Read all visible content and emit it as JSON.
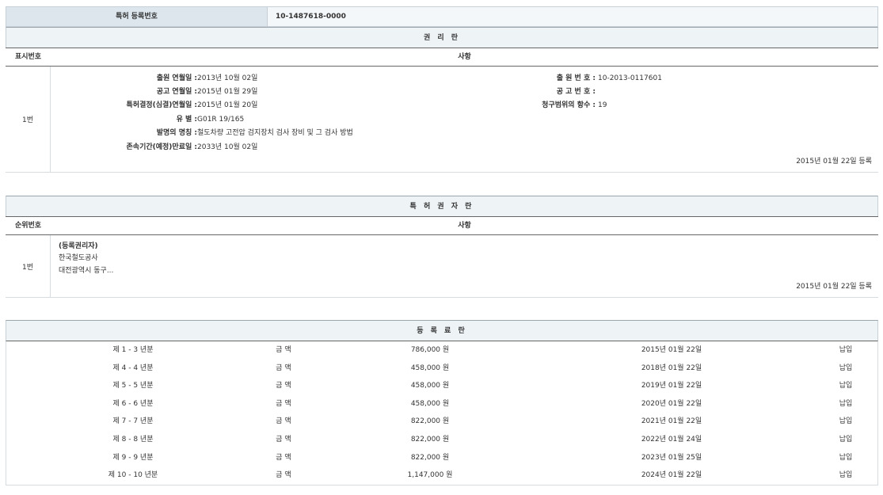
{
  "registration": {
    "label": "특허 등록번호",
    "number": "10-1487618-0000"
  },
  "rights_section": {
    "title": "권 리 란",
    "col_index": "표시번호",
    "col_details": "사항",
    "entry_index": "1번",
    "fields_left": [
      {
        "key": "출원 연월일 : ",
        "value": "2013년 10월 02일"
      },
      {
        "key": "공고 연월일 : ",
        "value": "2015년 01월 29일"
      },
      {
        "key": "특허결정(심결)연월일 : ",
        "value": "2015년 01월 20일"
      },
      {
        "key": "유 별 : ",
        "value": "G01R 19/165"
      },
      {
        "key": "발명의 명칭 : ",
        "value": "철도차량 고전압 검지장치 검사 장비 및 그 검사 방법"
      },
      {
        "key": "존속기간(예정)만료일 : ",
        "value": "2033년 10월 02일"
      }
    ],
    "fields_right": [
      {
        "key": "출 원 번 호 : ",
        "value": "10-2013-0117601"
      },
      {
        "key": "공 고 번 호 : ",
        "value": ""
      },
      {
        "key": "청구범위의 항수 : ",
        "value": "19"
      }
    ],
    "registered_date": "2015년 01월 22일 등록"
  },
  "holder_section": {
    "title": "특 허 권 자 란",
    "col_index": "순위번호",
    "col_details": "사항",
    "entry_index": "1번",
    "lines": [
      "(등록권리자)",
      "한국철도공사",
      "대전광역시 동구..."
    ],
    "registered_date": "2015년 01월 22일 등록"
  },
  "fee_section": {
    "title": "등 록 료 란",
    "rows": [
      {
        "year": "제 1 - 3 년분",
        "label": "금 액",
        "amount": "786,000 원",
        "date": "2015년 01월 22일",
        "status": "납입"
      },
      {
        "year": "제 4 - 4 년분",
        "label": "금 액",
        "amount": "458,000 원",
        "date": "2018년 01월 22일",
        "status": "납입"
      },
      {
        "year": "제 5 - 5 년분",
        "label": "금 액",
        "amount": "458,000 원",
        "date": "2019년 01월 22일",
        "status": "납입"
      },
      {
        "year": "제 6 - 6 년분",
        "label": "금 액",
        "amount": "458,000 원",
        "date": "2020년 01월 22일",
        "status": "납입"
      },
      {
        "year": "제 7 - 7 년분",
        "label": "금 액",
        "amount": "822,000 원",
        "date": "2021년 01월 22일",
        "status": "납입"
      },
      {
        "year": "제 8 - 8 년분",
        "label": "금 액",
        "amount": "822,000 원",
        "date": "2022년 01월 24일",
        "status": "납입"
      },
      {
        "year": "제 9 - 9 년분",
        "label": "금 액",
        "amount": "822,000 원",
        "date": "2023년 01월 25일",
        "status": "납입"
      },
      {
        "year": "제 10 - 10 년분",
        "label": "금 액",
        "amount": "1,147,000 원",
        "date": "2024년 01월 22일",
        "status": "납입"
      }
    ]
  }
}
